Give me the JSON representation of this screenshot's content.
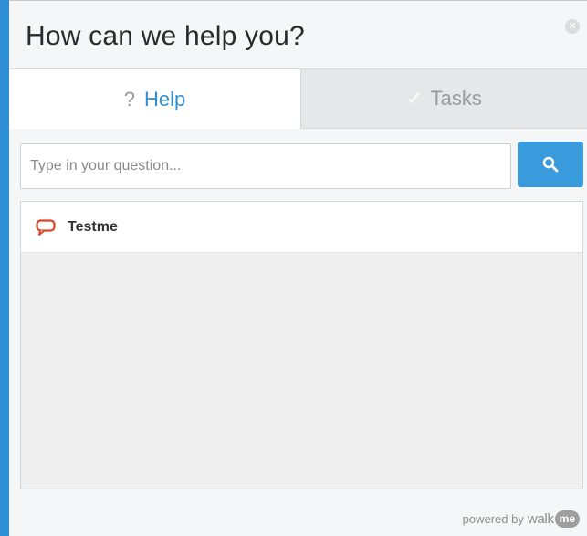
{
  "header": {
    "title": "How can we help you?",
    "close_icon": "close-icon"
  },
  "tabs": [
    {
      "label": "Help",
      "icon": "question-icon",
      "icon_glyph": "?",
      "active": true
    },
    {
      "label": "Tasks",
      "icon": "checkmark-icon",
      "icon_glyph": "✓",
      "active": false
    }
  ],
  "search": {
    "placeholder": "Type in your question...",
    "value": "",
    "button_icon": "search-icon"
  },
  "results": [
    {
      "label": "Testme",
      "icon": "speech-bubble-icon"
    }
  ],
  "footer": {
    "powered_text": "powered by",
    "brand_text": "walk",
    "brand_badge": "me"
  },
  "colors": {
    "accent": "#2f8fd4",
    "search_button": "#3a9bdc",
    "result_icon": "#d9472b",
    "panel_background": "#f5f6f8"
  }
}
